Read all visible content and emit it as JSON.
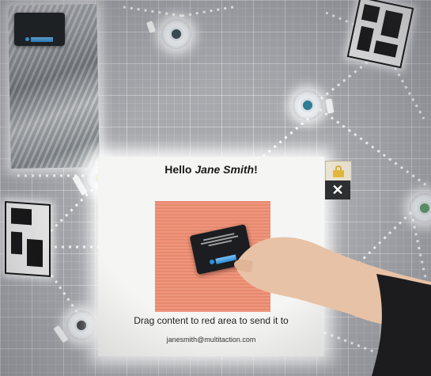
{
  "panel": {
    "greeting_prefix": "Hello ",
    "greeting_name": "Jane Smith",
    "greeting_suffix": "!",
    "instruction": "Drag content to red area to send it to",
    "email": "janesmith@multitaction.com"
  },
  "colors": {
    "drop_area": "#ee8d72",
    "panel_background": "#f5f5f3",
    "table_surface": "#a7a9ad",
    "card": "#1b1d20"
  },
  "icons": {
    "lock": "lock-icon",
    "close": "close-icon"
  }
}
